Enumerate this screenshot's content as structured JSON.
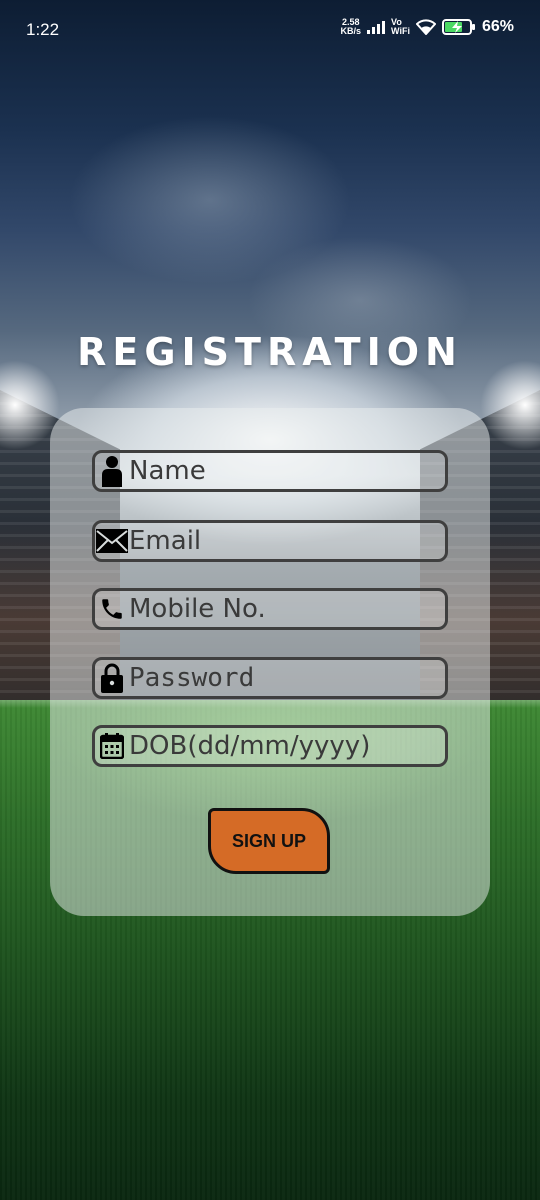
{
  "status_bar": {
    "time": "1:22",
    "net_speed_value": "2.58",
    "net_speed_unit": "KB/s",
    "vo_label": "Vo",
    "wifi_label": "WiFi",
    "battery_percent": "66%",
    "icons": [
      "signal-icon",
      "wifi-icon",
      "battery-charging-icon"
    ]
  },
  "title": "REGISTRATION",
  "form": {
    "name": {
      "placeholder": "Name",
      "icon": "person-icon"
    },
    "email": {
      "placeholder": "Email",
      "icon": "envelope-icon"
    },
    "mobile": {
      "placeholder": "Mobile No.",
      "icon": "phone-icon"
    },
    "password": {
      "placeholder": "Password",
      "icon": "lock-icon"
    },
    "dob": {
      "placeholder": "DOB(dd/mm/yyyy)",
      "icon": "calendar-icon"
    },
    "signup_label": "SIGN UP"
  },
  "colors": {
    "button": "#d56b26",
    "field_border": "#3f3f3f",
    "title": "#ffffff"
  }
}
